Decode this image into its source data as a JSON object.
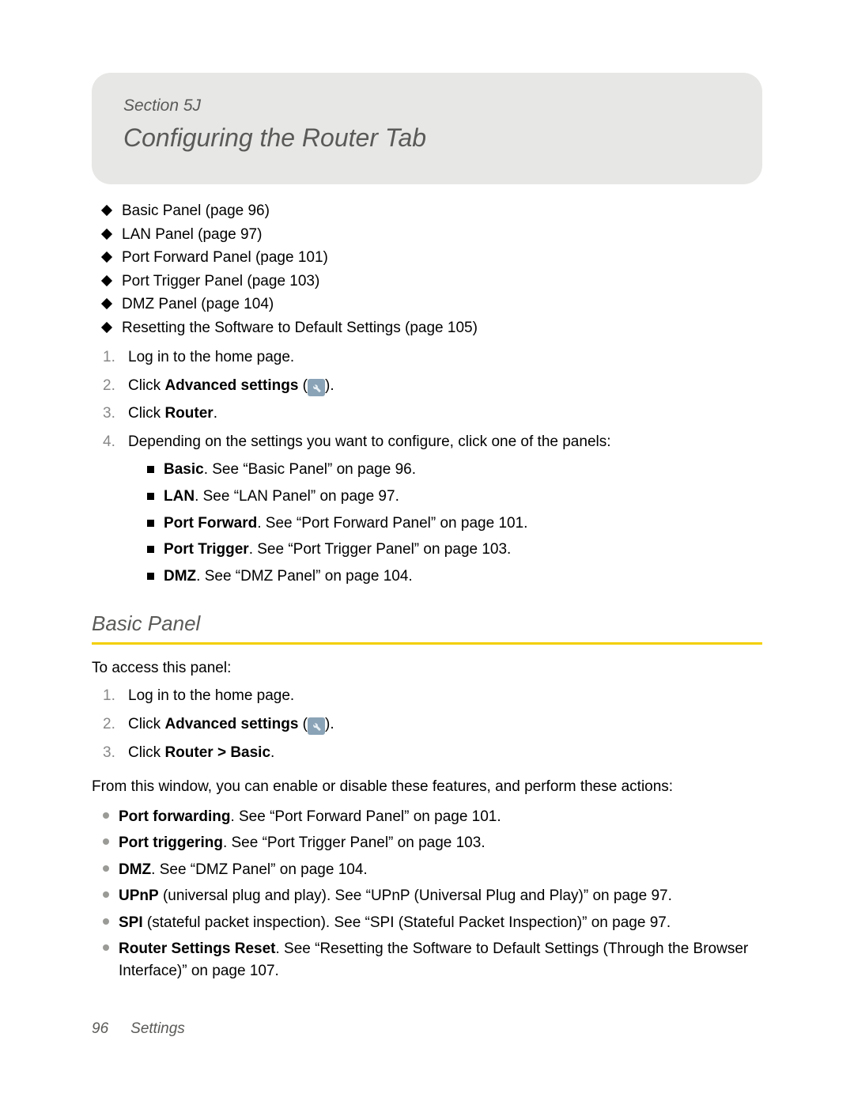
{
  "header": {
    "section_label": "Section 5J",
    "title": "Configuring the Router Tab"
  },
  "toc": [
    "Basic Panel (page 96)",
    "LAN Panel (page 97)",
    "Port Forward Panel (page 101)",
    "Port Trigger Panel (page 103)",
    "DMZ Panel (page 104)",
    "Resetting the Software to Default Settings (page 105)"
  ],
  "steps1": {
    "s1": "Log in to the home page.",
    "s2_pre": "Click ",
    "s2_bold": "Advanced settings",
    "s2_post": " (",
    "s2_close": ").",
    "s3_pre": "Click ",
    "s3_bold": "Router",
    "s3_post": ".",
    "s4": "Depending on the settings you want to configure, click one of the panels:",
    "sub": [
      {
        "b": "Basic",
        "rest": ". See “Basic Panel” on page 96."
      },
      {
        "b": "LAN",
        "rest": ". See “LAN Panel” on page 97."
      },
      {
        "b": "Port Forward",
        "rest": ". See “Port Forward Panel” on page 101."
      },
      {
        "b": "Port Trigger",
        "rest": ". See “Port Trigger Panel” on page 103."
      },
      {
        "b": "DMZ",
        "rest": ". See “DMZ Panel” on page 104."
      }
    ]
  },
  "h2": "Basic Panel",
  "para_access": "To access this panel:",
  "steps2": {
    "s1": "Log in to the home page.",
    "s2_pre": "Click ",
    "s2_bold": "Advanced settings",
    "s2_post": " (",
    "s2_close": ").",
    "s3_pre": "Click ",
    "s3_bold": "Router > Basic",
    "s3_post": "."
  },
  "para_from": "From this window, you can enable or disable these features, and perform these actions:",
  "features": [
    {
      "b": "Port forwarding",
      "rest": ". See “Port Forward Panel” on page 101."
    },
    {
      "b": "Port triggering",
      "rest": ". See “Port Trigger Panel” on page 103."
    },
    {
      "b": "DMZ",
      "rest": ". See “DMZ Panel” on page 104."
    },
    {
      "b": "UPnP",
      "rest": " (universal plug and play). See “UPnP (Universal Plug and Play)” on page 97."
    },
    {
      "b": "SPI",
      "rest": " (stateful packet inspection). See “SPI (Stateful Packet Inspection)” on page 97."
    },
    {
      "b": "Router Settings Reset",
      "rest": ". See “Resetting the Software to Default Settings (Through the Browser Interface)” on page 107."
    }
  ],
  "footer": {
    "page": "96",
    "label": "Settings"
  }
}
